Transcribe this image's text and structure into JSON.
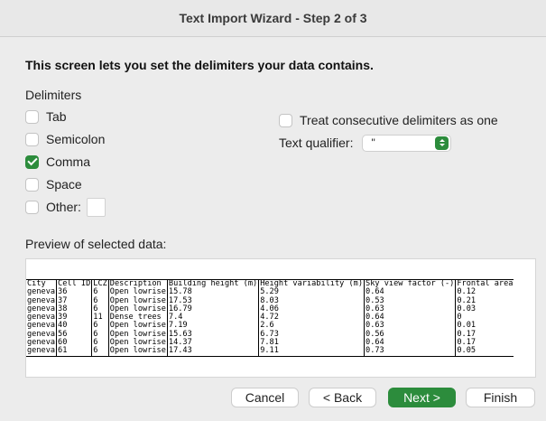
{
  "window": {
    "title": "Text Import Wizard - Step 2 of 3"
  },
  "instructions": "This screen lets you set the delimiters your data contains.",
  "delimiters": {
    "label": "Delimiters",
    "tab": {
      "label": "Tab",
      "checked": false
    },
    "semicolon": {
      "label": "Semicolon",
      "checked": false
    },
    "comma": {
      "label": "Comma",
      "checked": true
    },
    "space": {
      "label": "Space",
      "checked": false
    },
    "other": {
      "label": "Other:",
      "checked": false,
      "value": ""
    }
  },
  "options": {
    "consecutive_label": "Treat consecutive delimiters as one",
    "consecutive_checked": false,
    "qualifier_label": "Text qualifier:",
    "qualifier_value": "\""
  },
  "preview": {
    "label": "Preview of selected data:",
    "headers": [
      "City",
      "Cell ID",
      "LCZ",
      "Description",
      "Building height (m)",
      "Height variability (m)",
      "Sky view factor (-)",
      "Frontal area"
    ],
    "rows": [
      [
        "geneva",
        "36",
        "6",
        "Open lowrise",
        "15.78",
        "5.29",
        "0.64",
        "0.12"
      ],
      [
        "geneva",
        "37",
        "6",
        "Open lowrise",
        "17.53",
        "8.03",
        "0.53",
        "0.21"
      ],
      [
        "geneva",
        "38",
        "6",
        "Open lowrise",
        "16.79",
        "4.06",
        "0.63",
        "0.03"
      ],
      [
        "geneva",
        "39",
        "11",
        "Dense trees",
        "7.4",
        "4.72",
        "0.64",
        "0"
      ],
      [
        "geneva",
        "40",
        "6",
        "Open lowrise",
        "7.19",
        "2.6",
        "0.63",
        "0.01"
      ],
      [
        "geneva",
        "56",
        "6",
        "Open lowrise",
        "15.63",
        "6.73",
        "0.56",
        "0.17"
      ],
      [
        "geneva",
        "60",
        "6",
        "Open lowrise",
        "14.37",
        "7.81",
        "0.64",
        "0.17"
      ],
      [
        "geneva",
        "61",
        "6",
        "Open lowrise",
        "17.43",
        "9.11",
        "0.73",
        "0.05"
      ]
    ]
  },
  "buttons": {
    "cancel": "Cancel",
    "back": "< Back",
    "next": "Next >",
    "finish": "Finish"
  },
  "colors": {
    "accent": "#2c8c3c"
  }
}
